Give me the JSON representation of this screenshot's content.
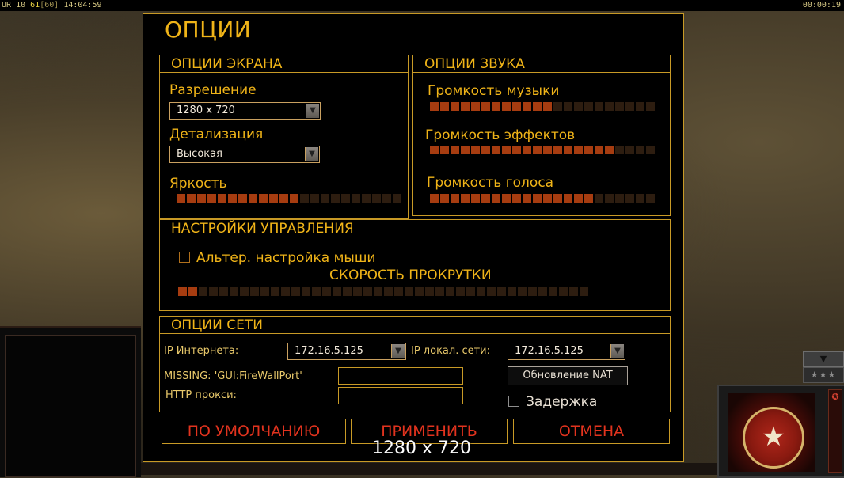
{
  "hud": {
    "left_prefix": "UR",
    "left_num": "10",
    "fps": "61",
    "fps_cap": "[60]",
    "clock": "14:04:59",
    "timer": "00:00:19"
  },
  "dialog": {
    "title": "ОПЦИИ"
  },
  "screen_options": {
    "header": "ОПЦИИ ЭКРАНА",
    "resolution_label": "Разрешение",
    "resolution_value": "1280 x 720",
    "detail_label": "Детализация",
    "detail_value": "Высокая",
    "brightness_label": "Яркость",
    "brightness_level": "12/22"
  },
  "sound_options": {
    "header": "ОПЦИИ ЗВУКА",
    "music_label": "Громкость музыки",
    "music_level": "12/22",
    "effects_label": "Громкость эффектов",
    "effects_level": "18/22",
    "voice_label": "Громкость голоса",
    "voice_level": "16/22"
  },
  "control_options": {
    "header": "НАСТРОЙКИ УПРАВЛЕНИЯ",
    "alt_mouse_label": "Альтер. настройка мыши",
    "alt_mouse_checked": false,
    "scroll_speed_label": "СКОРОСТЬ ПРОКРУТКИ",
    "scroll_speed_level": "2/40"
  },
  "network_options": {
    "header": "ОПЦИИ СЕТИ",
    "internet_ip_label": "IP Интернета:",
    "internet_ip_value": "172.16.5.125",
    "lan_ip_label": "IP локал. сети:",
    "lan_ip_value": "172.16.5.125",
    "firewall_label": "MISSING: 'GUI:FireWallPort'",
    "firewall_value": "",
    "proxy_label": "HTTP прокси:",
    "proxy_value": "",
    "nat_button": "Обновление NAT",
    "lag_label": "Задержка",
    "lag_checked": false
  },
  "buttons": {
    "default": "ПО УМОЛЧАНИЮ",
    "apply": "ПРИМЕНИТЬ",
    "cancel": "ОТМЕНА"
  },
  "overlay_caption": "1280 x 720",
  "right_panel": {
    "stars": "★★★"
  }
}
